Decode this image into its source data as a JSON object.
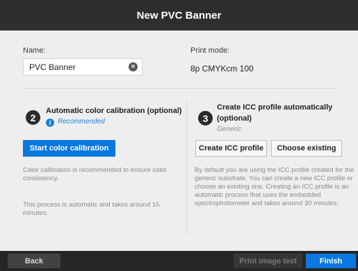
{
  "header": {
    "title": "New PVC Banner"
  },
  "name": {
    "label": "Name:",
    "value": "PVC Banner"
  },
  "print_mode": {
    "label": "Print mode:",
    "value": "8p CMYKcm 100"
  },
  "step2": {
    "number": "2",
    "title": "Automatic color calibration (optional)",
    "recommended": "Recommended",
    "button": "Start color calibration",
    "desc1": "Color calibration is recommended to ensure color consistency.",
    "desc2": "This process is automatic and takes around 15 minutes."
  },
  "step3": {
    "number": "3",
    "title_line1": "Create ICC profile automatically",
    "title_line2": "(optional)",
    "generic": "Generic",
    "create_button": "Create ICC profile",
    "choose_button": "Choose existing",
    "desc": "By default you are using the ICC profile created for the generic substrate. You can create a new ICC profile or choose an existing one. Creating an ICC profile is an automatic process that uses the embedded spectrophotometer and takes around 30 minutes."
  },
  "footer": {
    "back": "Back",
    "print_test": "Print image test",
    "finish": "Finish"
  },
  "colors": {
    "accent": "#0a78e0",
    "header_bg": "#2e2e2e",
    "content_bg": "#eeeeee"
  }
}
